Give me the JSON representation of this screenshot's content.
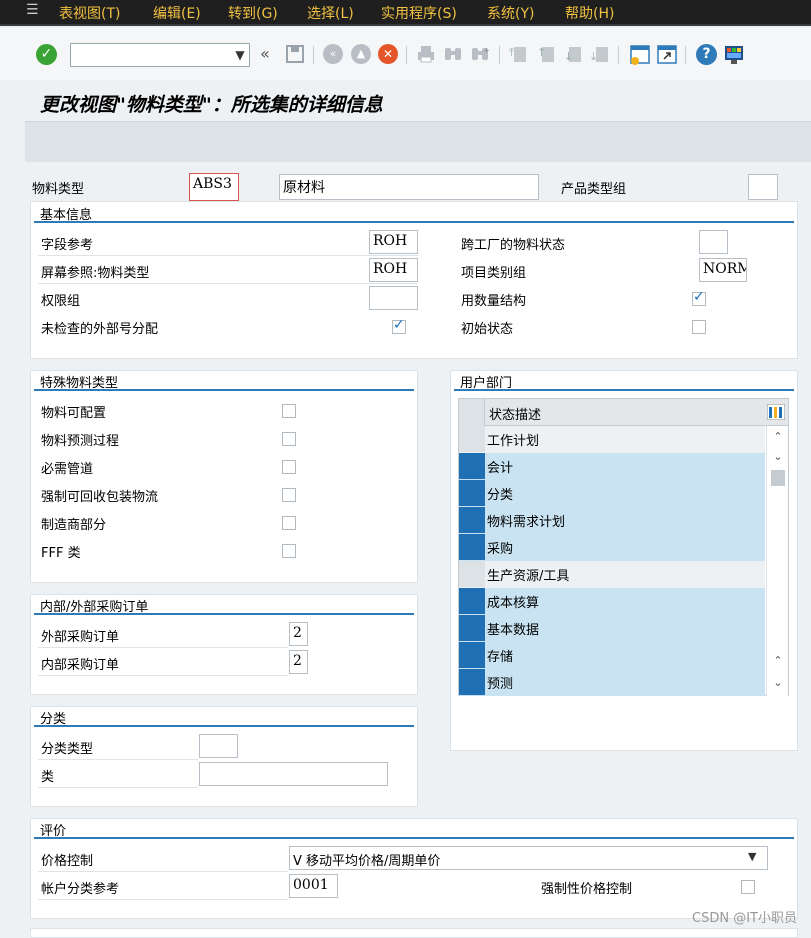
{
  "menu": {
    "items": [
      "表视图(T)",
      "编辑(E)",
      "转到(G)",
      "选择(L)",
      "实用程序(S)",
      "系统(Y)",
      "帮助(H)"
    ]
  },
  "toolbar": {
    "command_value": "",
    "collapse_label": "«",
    "icons": [
      "enter-icon",
      "save-icon",
      "back-icon",
      "exit-icon",
      "cancel-icon",
      "print-icon",
      "find-icon",
      "find-next-icon",
      "first-page-icon",
      "previous-page-icon",
      "next-page-icon",
      "last-page-icon",
      "create-session-icon",
      "shortcut-icon",
      "help-icon",
      "customize-layout-icon"
    ]
  },
  "page": {
    "title": "更改视图\"物料类型\"：所选集的详细信息"
  },
  "header_fields": {
    "material_type_label": "物料类型",
    "material_type_value": "ABS3",
    "material_type_desc": "原材料",
    "product_type_group_label": "产品类型组",
    "product_type_group_value": ""
  },
  "basic_info": {
    "title": "基本信息",
    "field_ref_label": "字段参考",
    "field_ref_value": "ROH",
    "screen_ref_label": "屏幕参照:物料类型",
    "screen_ref_value": "ROH",
    "auth_group_label": "权限组",
    "auth_group_value": "",
    "unchecked_ext_no_label": "未检查的外部号分配",
    "unchecked_ext_no_checked": true,
    "cross_plant_status_label": "跨工厂的物料状态",
    "cross_plant_status_value": "",
    "item_cat_group_label": "项目类别组",
    "item_cat_group_value": "NORM",
    "qty_structure_label": "用数量结构",
    "qty_structure_checked": true,
    "initial_status_label": "初始状态",
    "initial_status_checked": false
  },
  "special_material": {
    "title": "特殊物料类型",
    "items": [
      {
        "label": "物料可配置",
        "checked": false
      },
      {
        "label": "物料预测过程",
        "checked": false
      },
      {
        "label": "必需管道",
        "checked": false
      },
      {
        "label": "强制可回收包装物流",
        "checked": false
      },
      {
        "label": "制造商部分",
        "checked": false
      },
      {
        "label": "FFF 类",
        "checked": false
      }
    ]
  },
  "purchase_orders": {
    "title": "内部/外部采购订单",
    "external_label": "外部采购订单",
    "external_value": "2",
    "internal_label": "内部采购订单",
    "internal_value": "2"
  },
  "classification": {
    "title": "分类",
    "class_type_label": "分类类型",
    "class_type_value": "",
    "class_label": "类",
    "class_value": ""
  },
  "user_dept": {
    "title": "用户部门",
    "column_header": "状态描述",
    "rows": [
      {
        "text": "工作计划",
        "selected": false
      },
      {
        "text": "会计",
        "selected": true
      },
      {
        "text": "分类",
        "selected": true
      },
      {
        "text": "物料需求计划",
        "selected": true
      },
      {
        "text": "采购",
        "selected": true
      },
      {
        "text": "生产资源/工具",
        "selected": false
      },
      {
        "text": "成本核算",
        "selected": true
      },
      {
        "text": "基本数据",
        "selected": true
      },
      {
        "text": "存储",
        "selected": true
      },
      {
        "text": "预测",
        "selected": true
      }
    ]
  },
  "valuation": {
    "title": "评价",
    "price_control_label": "价格控制",
    "price_control_value": "V 移动平均价格/周期单价",
    "acct_cat_ref_label": "帐户分类参考",
    "acct_cat_ref_value": "0001",
    "forced_price_control_label": "强制性价格控制",
    "forced_price_control_checked": false
  },
  "watermark": "CSDN @IT小职员",
  "colors": {
    "accent": "#2f7ab8",
    "selected_row": "#c9e3f2",
    "selected_marker": "#1f6fb5",
    "menu_text": "#f0c040"
  }
}
